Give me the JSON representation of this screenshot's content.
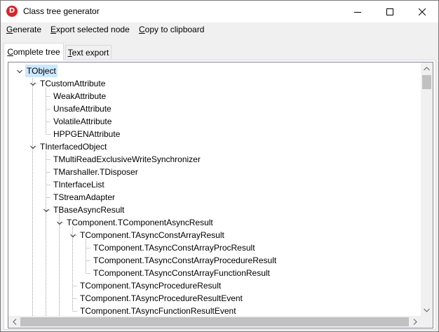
{
  "window": {
    "title": "Class tree generator",
    "icon_letter": "D",
    "accent_color": "#d6262b"
  },
  "menu": {
    "generate": {
      "pre": "",
      "key": "G",
      "post": "enerate"
    },
    "export": {
      "pre": "",
      "key": "E",
      "post": "xport selected node"
    },
    "copy": {
      "pre": "",
      "key": "C",
      "post": "opy to clipboard"
    }
  },
  "tabs": {
    "complete": {
      "pre": "",
      "key": "C",
      "post": "omplete tree"
    },
    "text": {
      "pre": "",
      "key": "T",
      "post": "ext export"
    }
  },
  "tree": {
    "selection_color": "#cce8ff",
    "nodes": [
      {
        "label": "TObject",
        "depth": 0,
        "expanded": true,
        "selected": true
      },
      {
        "label": "TCustomAttribute",
        "depth": 1,
        "expanded": true
      },
      {
        "label": "WeakAttribute",
        "depth": 2
      },
      {
        "label": "UnsafeAttribute",
        "depth": 2
      },
      {
        "label": "VolatileAttribute",
        "depth": 2
      },
      {
        "label": "HPPGENAttribute",
        "depth": 2
      },
      {
        "label": "TInterfacedObject",
        "depth": 1,
        "expanded": true
      },
      {
        "label": "TMultiReadExclusiveWriteSynchronizer",
        "depth": 2
      },
      {
        "label": "TMarshaller.TDisposer",
        "depth": 2
      },
      {
        "label": "TInterfaceList",
        "depth": 2
      },
      {
        "label": "TStreamAdapter",
        "depth": 2
      },
      {
        "label": "TBaseAsyncResult",
        "depth": 2,
        "expanded": true
      },
      {
        "label": "TComponent.TComponentAsyncResult",
        "depth": 3,
        "expanded": true
      },
      {
        "label": "TComponent.TAsyncConstArrayResult",
        "depth": 4,
        "expanded": true
      },
      {
        "label": "TComponent.TAsyncConstArrayProcResult",
        "depth": 5
      },
      {
        "label": "TComponent.TAsyncConstArrayProcedureResult",
        "depth": 5
      },
      {
        "label": "TComponent.TAsyncConstArrayFunctionResult",
        "depth": 5
      },
      {
        "label": "TComponent.TAsyncProcedureResult",
        "depth": 4
      },
      {
        "label": "TComponent.TAsyncProcedureResultEvent",
        "depth": 4
      },
      {
        "label": "TComponent.TAsyncFunctionResultEvent",
        "depth": 4
      }
    ]
  }
}
